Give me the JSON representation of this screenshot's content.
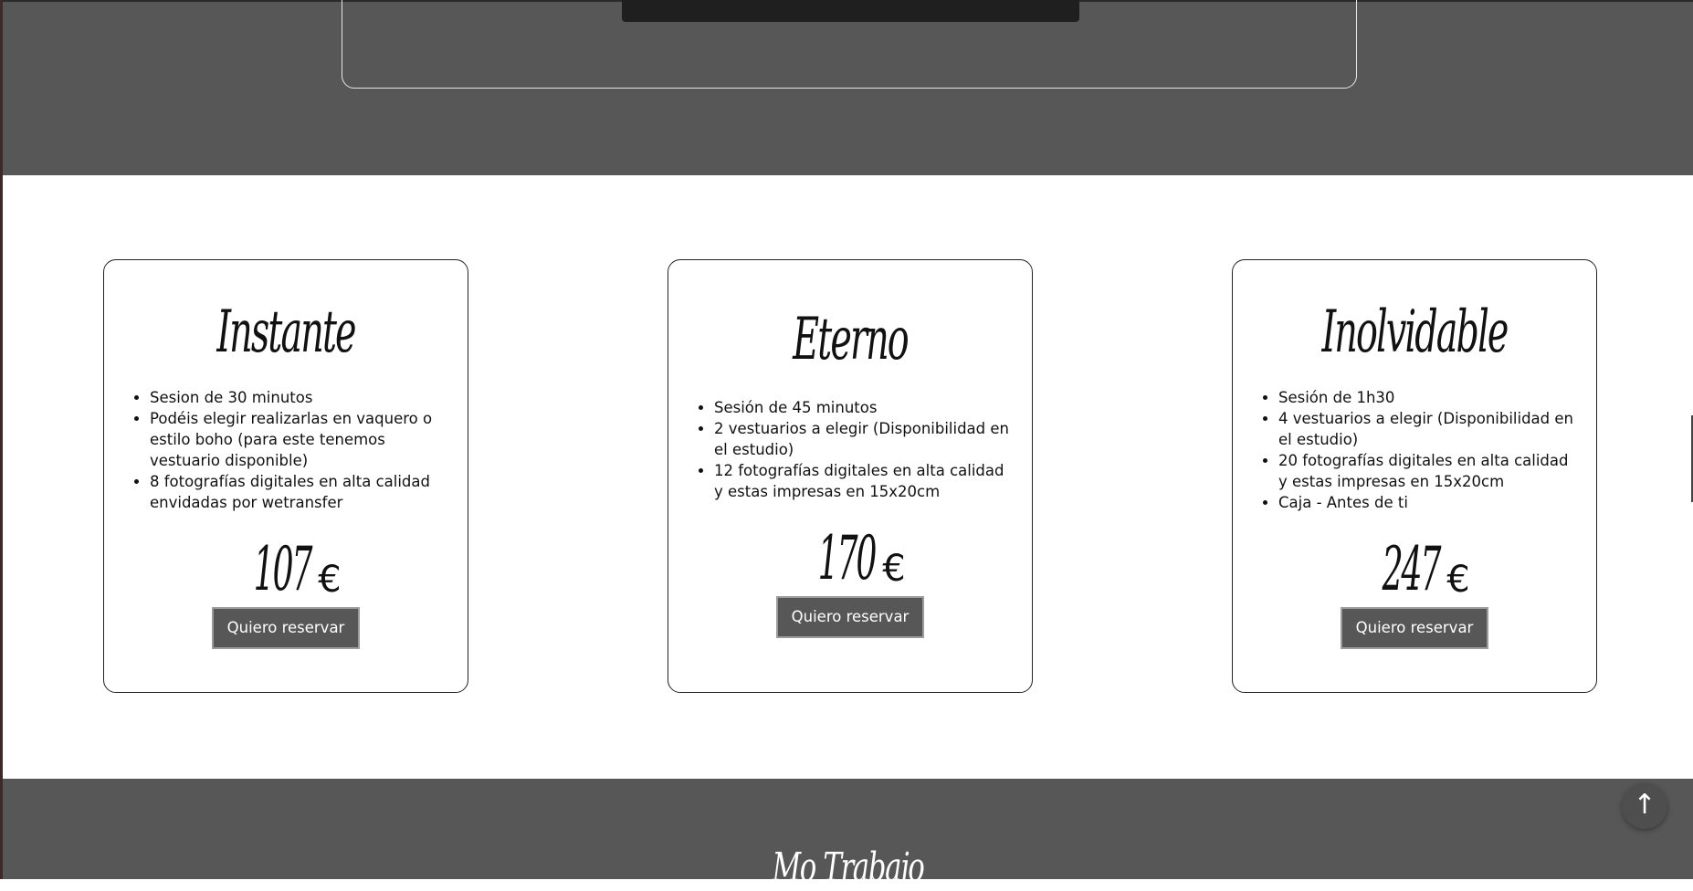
{
  "packages": [
    {
      "name": "Instante",
      "features": [
        "Sesion de 30 minutos",
        "Podéis elegir realizarlas en vaquero o estilo boho (para este tenemos vestuario disponible)",
        "8 fotografías digitales en alta calidad envidadas por wetransfer"
      ],
      "price": "107",
      "currency": "€",
      "button": "Quiero reservar"
    },
    {
      "name": "Eterno",
      "features": [
        "Sesión de 45 minutos",
        "2 vestuarios a elegir (Disponibilidad en el estudio)",
        "12 fotografías digitales en alta calidad y estas impresas en 15x20cm"
      ],
      "price": "170",
      "currency": "€",
      "button": "Quiero reservar"
    },
    {
      "name": "Inolvidable",
      "features": [
        "Sesión de 1h30",
        "4 vestuarios a elegir (Disponibilidad en el estudio)",
        "20 fotografías digitales en alta calidad y estas impresas en 15x20cm",
        "Caja - Antes de ti"
      ],
      "price": "247",
      "currency": "€",
      "button": "Quiero reservar"
    }
  ],
  "footer": {
    "title": "Mo Trabajo"
  },
  "scroll_top": {
    "icon": "arrow-up-icon",
    "glyph": "↑"
  },
  "colors": {
    "dark_section": "#575757",
    "button_bg": "#575757",
    "button_border": "#9c9c9c"
  }
}
